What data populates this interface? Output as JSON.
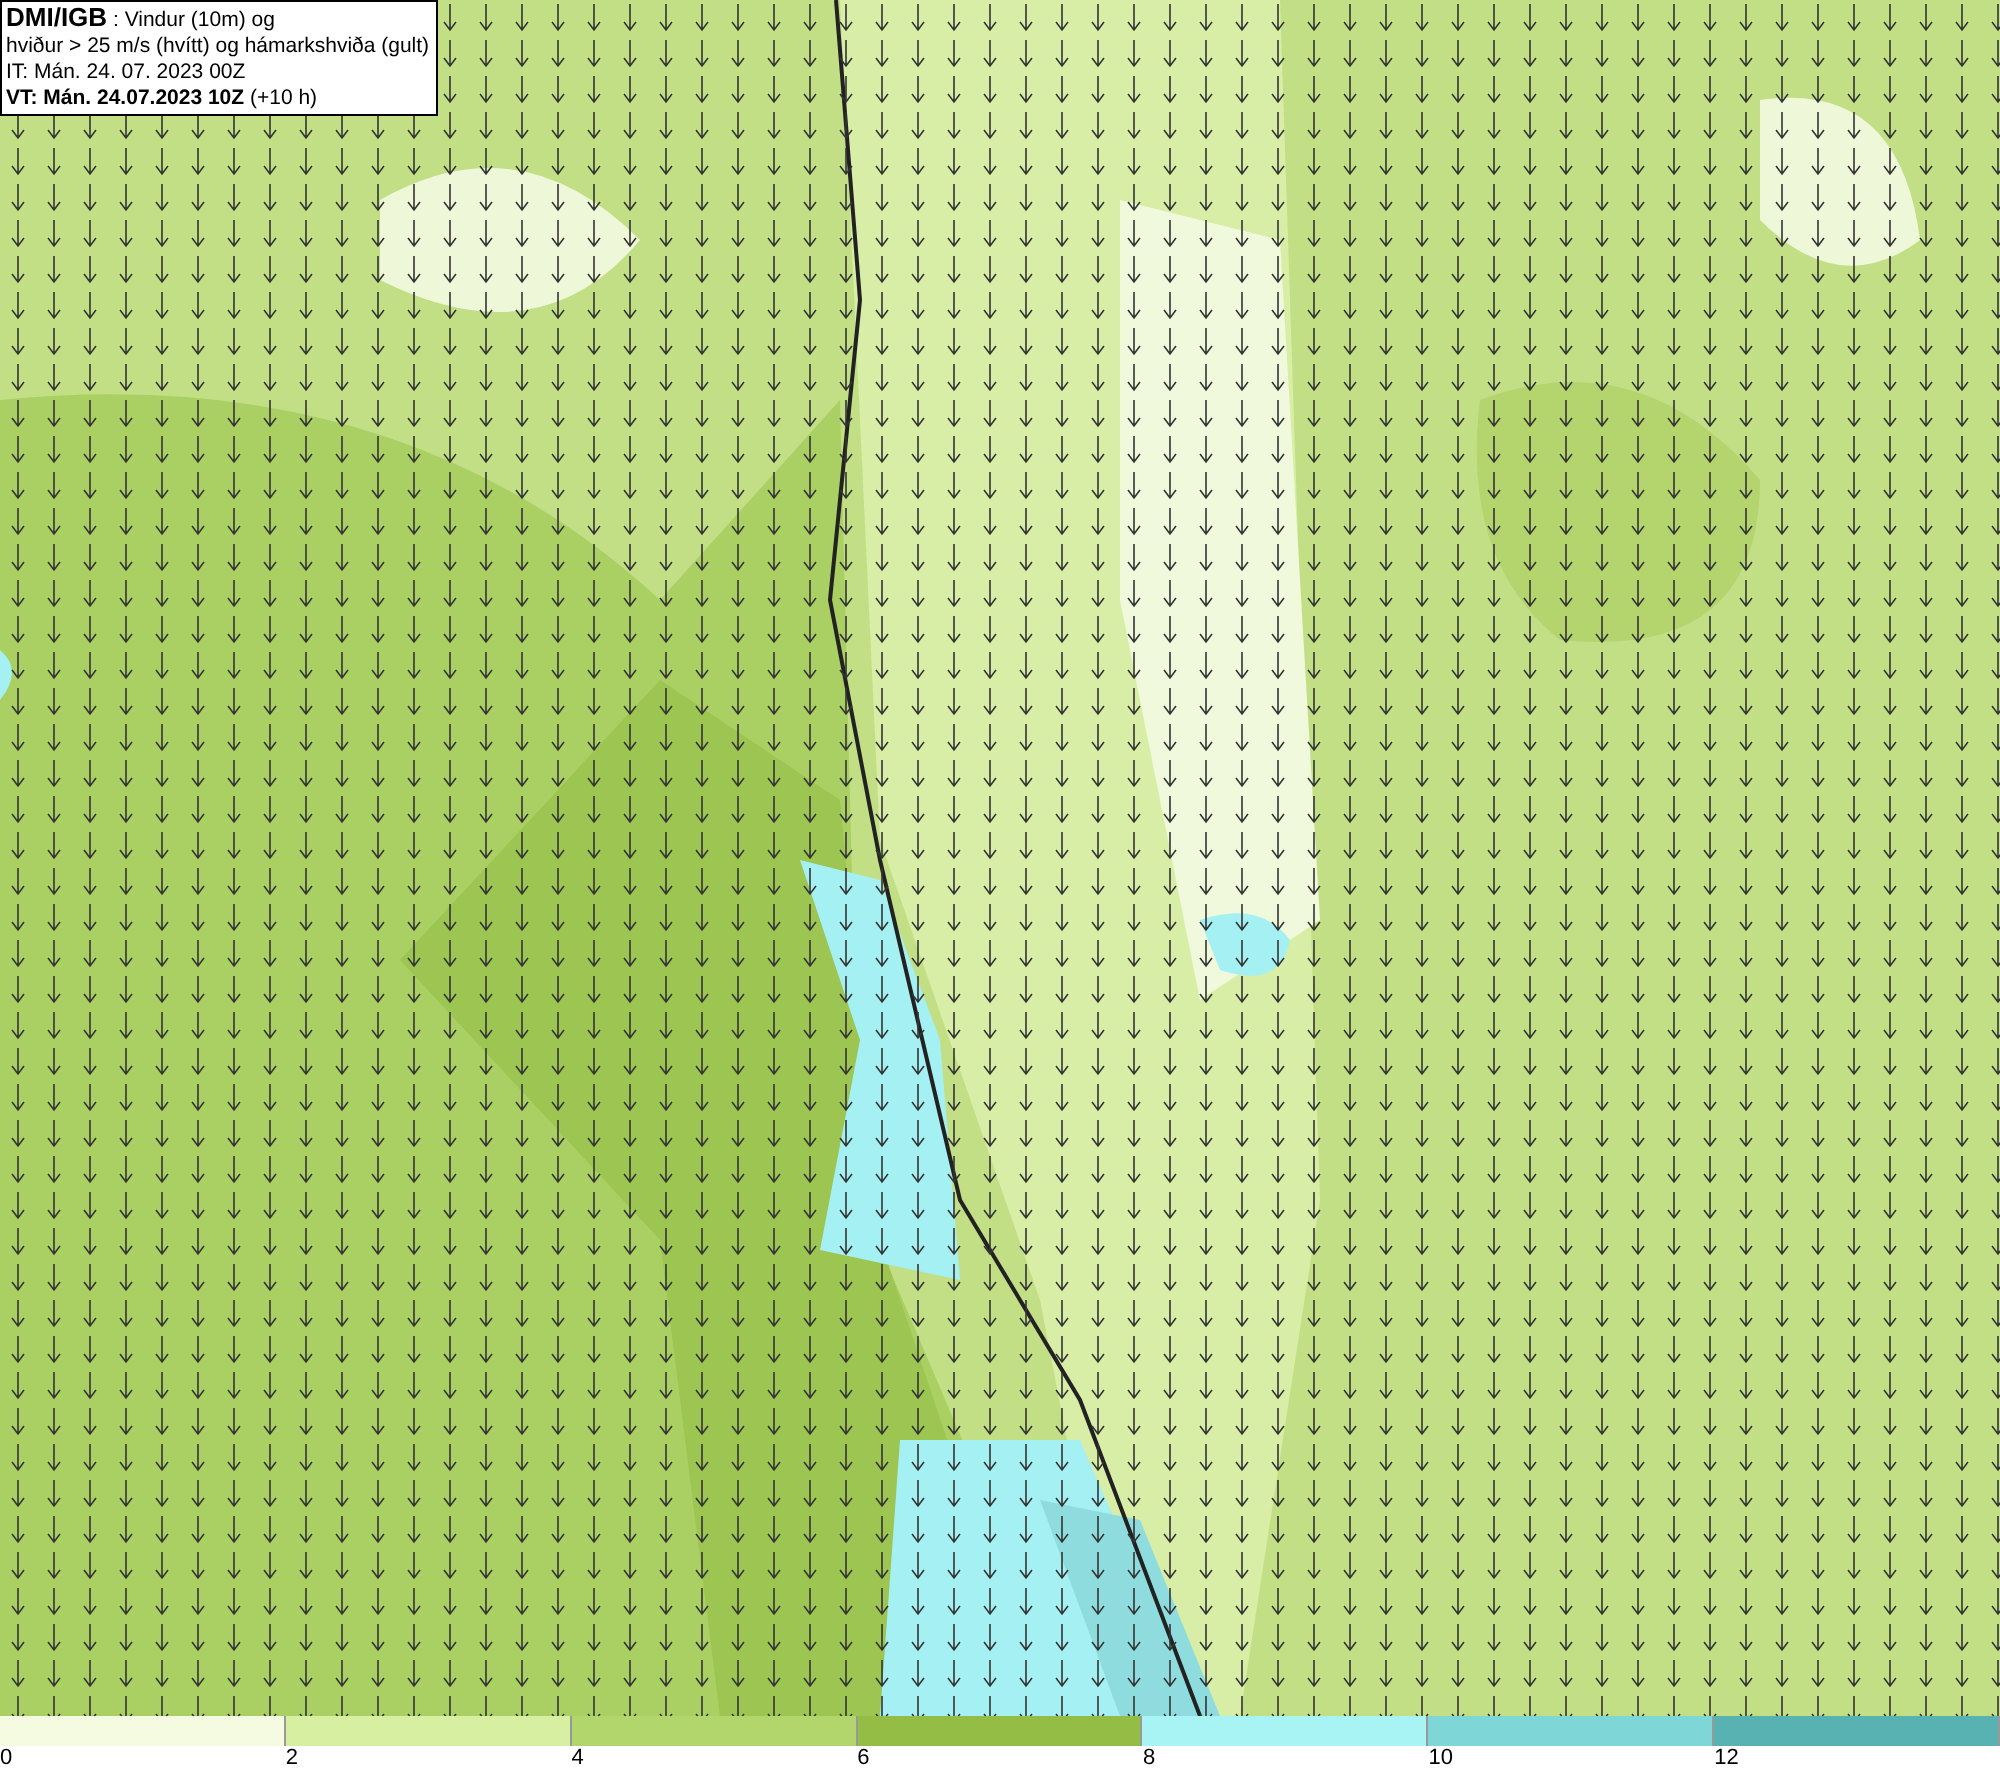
{
  "header": {
    "lines": [
      "**DMI/IGB** : Vindur (10m) og",
      "hviður > 25 m/s (hvítt) og hámarkshviða (gult)",
      "IT: Mán. 24. 07. 2023 00Z",
      "**VT: Mán. 24.07.2023 10Z** (+10 h)"
    ]
  },
  "legend": [
    {
      "label": "0",
      "color": "#f4fbe0"
    },
    {
      "label": "2",
      "color": "#d6efa0"
    },
    {
      "label": "4",
      "color": "#b2d66c"
    },
    {
      "label": "6",
      "color": "#94bd46"
    },
    {
      "label": "8",
      "color": "#a8f4f4"
    },
    {
      "label": "10",
      "color": "#7ed6d6"
    },
    {
      "label": "12",
      "color": "#58b2b2"
    }
  ]
}
